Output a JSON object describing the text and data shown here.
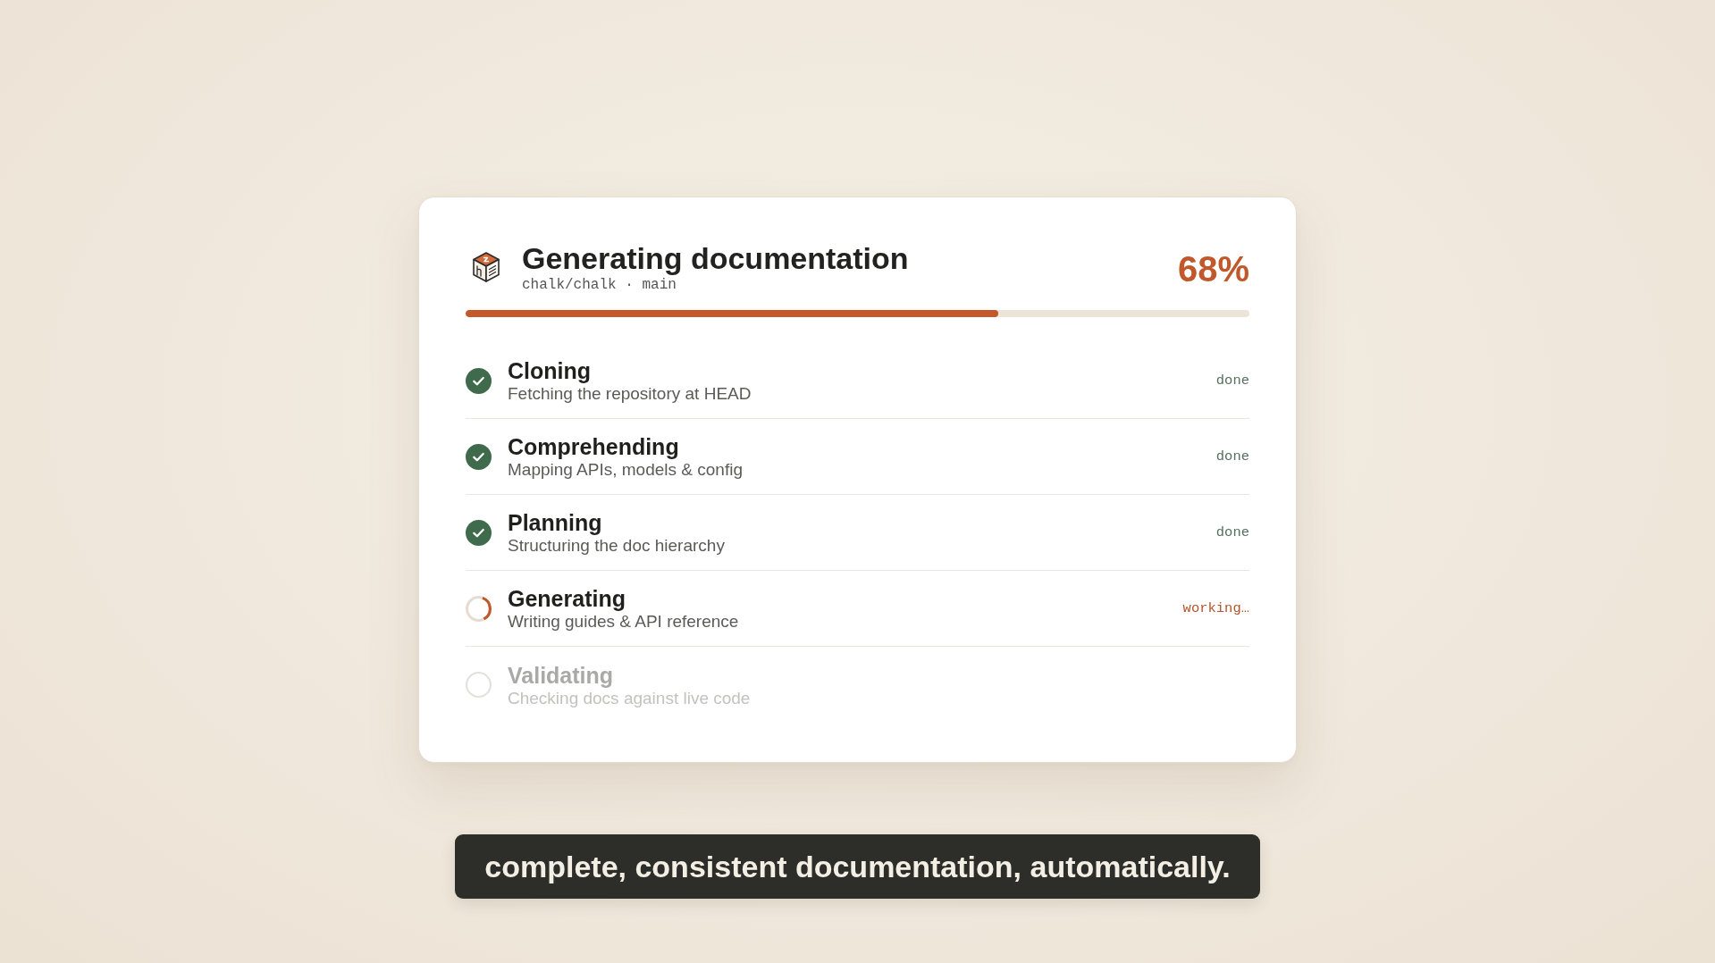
{
  "header": {
    "title": "Generating documentation",
    "repo": "chalk/chalk · main"
  },
  "progress": {
    "percent": "68%",
    "level": 0.68
  },
  "steps": [
    {
      "kind": "done",
      "name": "Cloning",
      "description": "Fetching the repository at HEAD",
      "status": "done"
    },
    {
      "kind": "done",
      "name": "Comprehending",
      "description": "Mapping APIs, models & config",
      "status": "done"
    },
    {
      "kind": "done",
      "name": "Planning",
      "description": "Structuring the doc hierarchy",
      "status": "done"
    },
    {
      "kind": "active",
      "name": "Generating",
      "description": "Writing guides & API reference",
      "status": "working…"
    },
    {
      "kind": "pending",
      "name": "Validating",
      "description": "Checking docs against live code"
    }
  ],
  "caption": "complete, consistent documentation, automatically."
}
